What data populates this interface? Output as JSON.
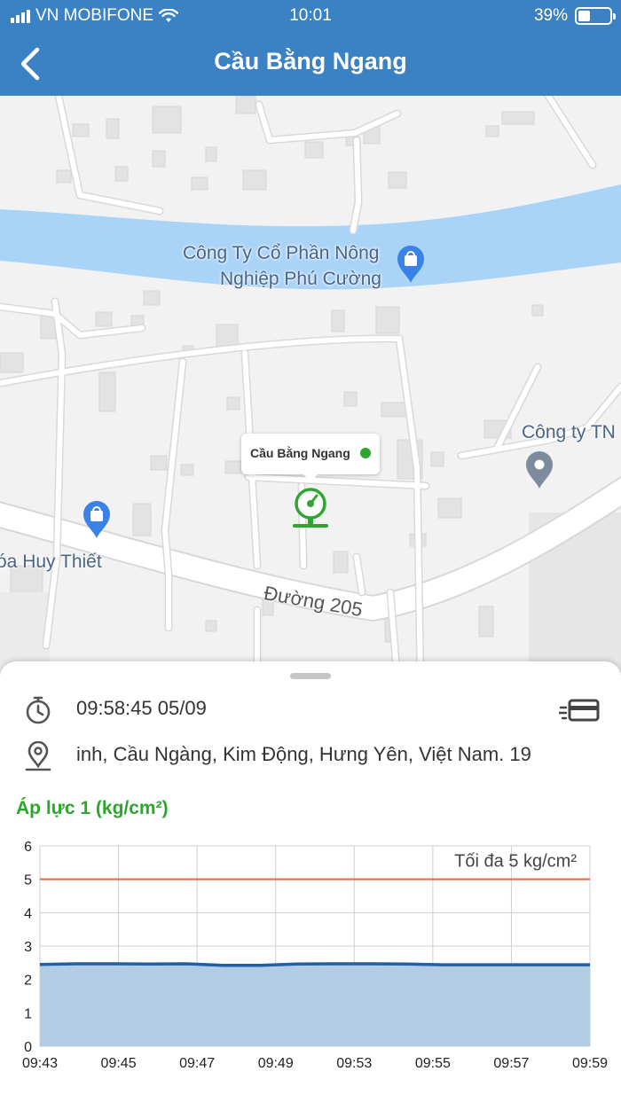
{
  "status_bar": {
    "carrier": "VN MOBIFONE",
    "time": "10:01",
    "battery": "39%",
    "battery_level": 0.39
  },
  "header": {
    "title": "Cầu Bằng Ngang"
  },
  "map": {
    "labels": {
      "company_line1": "Công Ty Cổ Phần Nông",
      "company_line2": "Nghiệp Phú Cường",
      "company2": "Công ty TN",
      "shop": "óa Huy Thiết",
      "road": "Đường 205"
    },
    "marker": {
      "callout_title": "Cầu Bằng Ngang",
      "status_color": "#2ea52e"
    }
  },
  "details": {
    "timestamp": "09:58:45  05/09",
    "address": "inh, Cầu Ngàng, Kim Động, Hưng Yên, Việt Nam.  19"
  },
  "chart_title": "Áp lực 1 (kg/cm²)",
  "chart_data": {
    "type": "area",
    "title": "",
    "xlabel": "",
    "ylabel": "",
    "ylim": [
      0,
      6
    ],
    "y_ticks": [
      "0",
      "1",
      "2",
      "3",
      "4",
      "5",
      "6"
    ],
    "x_ticks": [
      "09:43",
      "09:45",
      "09:47",
      "09:49",
      "09:53",
      "09:55",
      "09:57",
      "09:59"
    ],
    "grid": true,
    "series": [
      {
        "color": "#1f5fa6",
        "fill": "#b2cde3",
        "points": [
          2.45,
          2.47,
          2.47,
          2.46,
          2.47,
          2.42,
          2.42,
          2.46,
          2.47,
          2.47,
          2.46,
          2.44,
          2.44,
          2.44,
          2.44,
          2.44
        ]
      }
    ],
    "threshold": {
      "value": 5,
      "label": "Tối đa 5 kg/cm²",
      "color": "#e8673c"
    }
  },
  "colors": {
    "header": "#3a82c4",
    "accent_green": "#2ea52e",
    "water": "#aad3f8"
  }
}
